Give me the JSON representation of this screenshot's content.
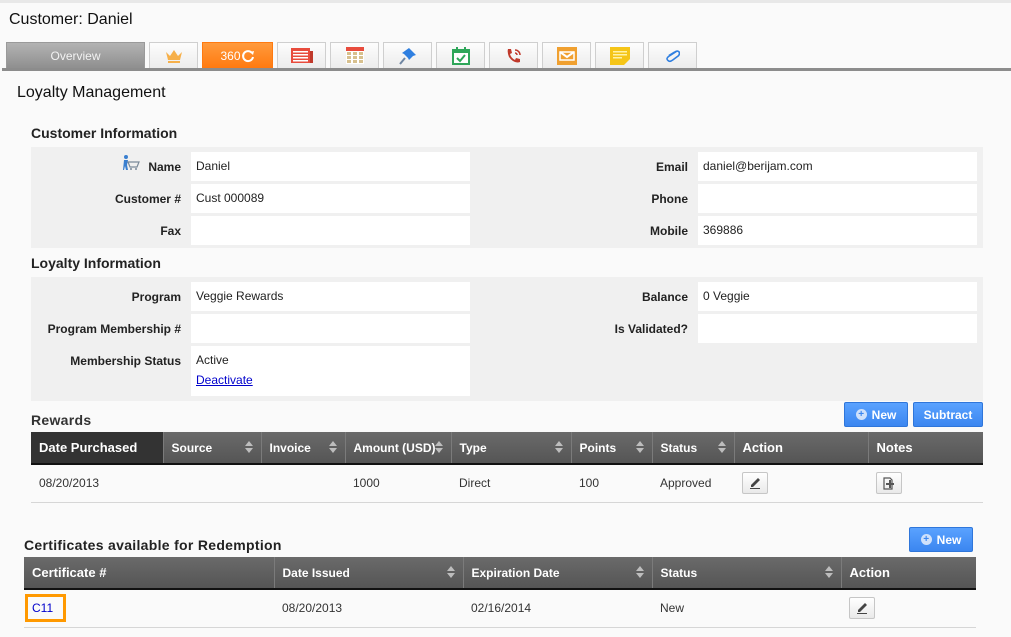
{
  "header": {
    "title": "Customer: Daniel"
  },
  "tabs": [
    {
      "id": "overview",
      "label": "Overview",
      "icon": ""
    },
    {
      "id": "loyalty",
      "label": "",
      "icon": "crown-icon"
    },
    {
      "id": "360",
      "label": "360",
      "icon": "refresh-icon",
      "active": true
    },
    {
      "id": "invoice",
      "label": "",
      "icon": "document-list-icon"
    },
    {
      "id": "calendar",
      "label": "",
      "icon": "calendar-icon"
    },
    {
      "id": "pin",
      "label": "",
      "icon": "pushpin-icon"
    },
    {
      "id": "tasks",
      "label": "",
      "icon": "calendar-check-icon"
    },
    {
      "id": "calls",
      "label": "",
      "icon": "phone-icon"
    },
    {
      "id": "email",
      "label": "",
      "icon": "envelope-icon"
    },
    {
      "id": "notes",
      "label": "",
      "icon": "sticky-note-icon"
    },
    {
      "id": "attachments",
      "label": "",
      "icon": "paperclip-icon"
    }
  ],
  "page": {
    "title": "Loyalty Management"
  },
  "customer_info": {
    "heading": "Customer Information",
    "name_label": "Name",
    "name": "Daniel",
    "customer_no_label": "Customer #",
    "customer_no": "Cust 000089",
    "fax_label": "Fax",
    "fax": "",
    "email_label": "Email",
    "email": "daniel@berijam.com",
    "phone_label": "Phone",
    "phone": "",
    "mobile_label": "Mobile",
    "mobile": "369886"
  },
  "loyalty_info": {
    "heading": "Loyalty Information",
    "program_label": "Program",
    "program": "Veggie Rewards",
    "membership_no_label": "Program Membership #",
    "membership_no": "",
    "status_label": "Membership Status",
    "status": "Active",
    "deactivate_link": "Deactivate",
    "balance_label": "Balance",
    "balance": "0 Veggie",
    "validated_label": "Is Validated?",
    "validated": ""
  },
  "rewards": {
    "heading": "Rewards",
    "new_button": "New",
    "subtract_button": "Subtract",
    "columns": [
      "Date Purchased",
      "Source",
      "Invoice",
      "Amount (USD)",
      "Type",
      "Points",
      "Status",
      "Action",
      "Notes"
    ],
    "rows": [
      {
        "date": "08/20/2013",
        "source": "",
        "invoice": "",
        "amount": "1000",
        "type": "Direct",
        "points": "100",
        "status": "Approved"
      }
    ]
  },
  "certificates": {
    "heading": "Certificates available for Redemption",
    "new_button": "New",
    "columns": [
      "Certificate #",
      "Date Issued",
      "Expiration Date",
      "Status",
      "Action"
    ],
    "rows": [
      {
        "certificate": "C11",
        "date_issued": "08/20/2013",
        "expiration": "02/16/2014",
        "status": "New"
      }
    ]
  }
}
